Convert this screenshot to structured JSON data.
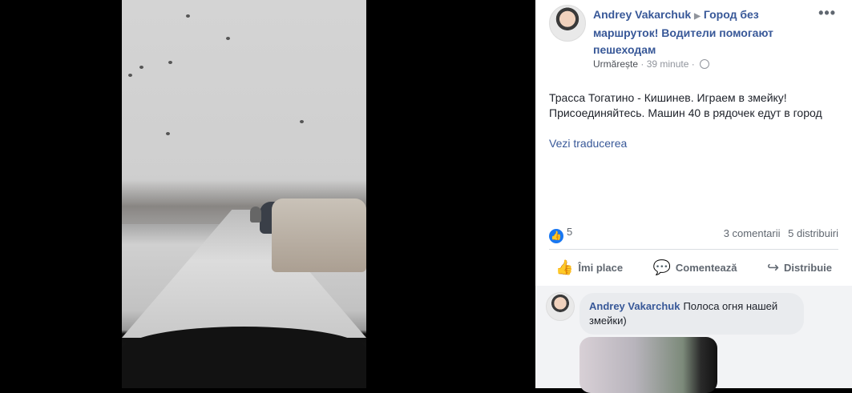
{
  "post": {
    "author": "Andrey Vakarchuk",
    "group": "Город без маршруток! Водители помогают пешеходам",
    "follow": "Urmărește",
    "time": "39 minute",
    "separator": "·",
    "text": "Трасса Тогатино - Кишинев. Играем в змейку! Присоединяйтесь. Машин 40 в рядочек едут в город",
    "translate": "Vezi traducerea",
    "likes": "5",
    "comments_count": "3 comentarii",
    "shares_count": "5 distribuiri"
  },
  "actions": {
    "like": "Îmi place",
    "comment": "Comentează",
    "share": "Distribuie"
  },
  "comment": {
    "author": "Andrey Vakarchuk",
    "text": "Полоса огня нашей змейки)"
  },
  "colors": {
    "link": "#385898",
    "like_blue": "#1877f2",
    "muted": "#90949c"
  },
  "icons": [
    "more-options-icon",
    "globe-icon",
    "like-icon",
    "comment-icon",
    "share-icon",
    "triangle-arrow-icon"
  ]
}
